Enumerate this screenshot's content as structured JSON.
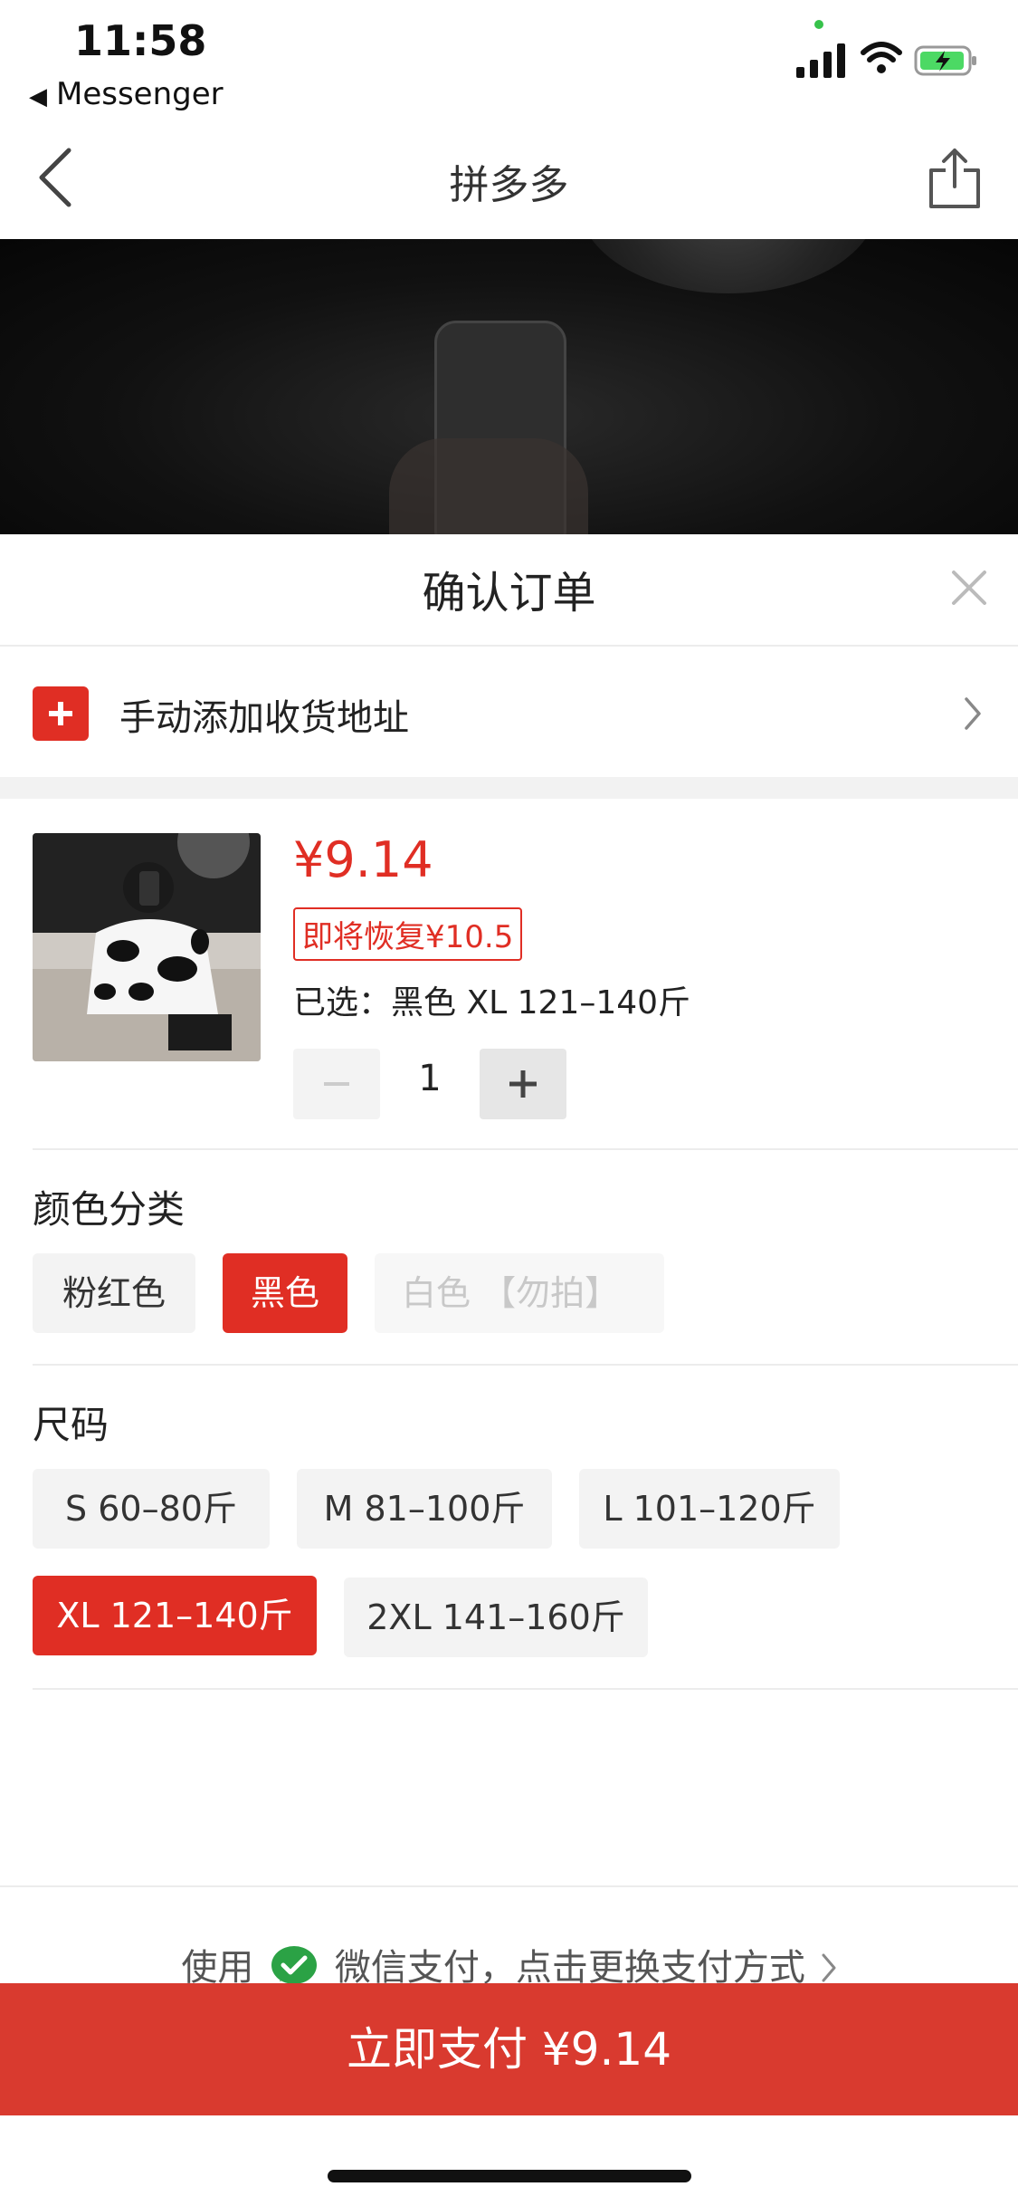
{
  "status_bar": {
    "time": "11:58",
    "back_app": "Messenger"
  },
  "nav": {
    "title": "拼多多"
  },
  "sheet": {
    "title": "确认订单",
    "address_label": "手动添加收货地址",
    "product": {
      "price": "¥9.14",
      "restore_tag": "即将恢复¥10.5",
      "selected": "已选：黑色 XL 121–140斤",
      "quantity": "1"
    },
    "color_section": {
      "title": "颜色分类",
      "options": [
        "粉红色",
        "黑色",
        "白色 【勿拍】"
      ],
      "selected": "黑色",
      "disabled": "白色 【勿拍】"
    },
    "size_section": {
      "title": "尺码",
      "options": [
        "S 60–80斤",
        "M 81–100斤",
        "L 101–120斤",
        "XL 121–140斤",
        "2XL 141–160斤"
      ],
      "selected": "XL 121–140斤"
    }
  },
  "payment": {
    "prefix": "使用",
    "method_text": "微信支付，点击更换支付方式",
    "pay_button": "立即支付 ¥9.14"
  },
  "colors": {
    "accent": "#e02e24",
    "pay_button": "#d93a2f",
    "wechat_green": "#2ba245"
  }
}
